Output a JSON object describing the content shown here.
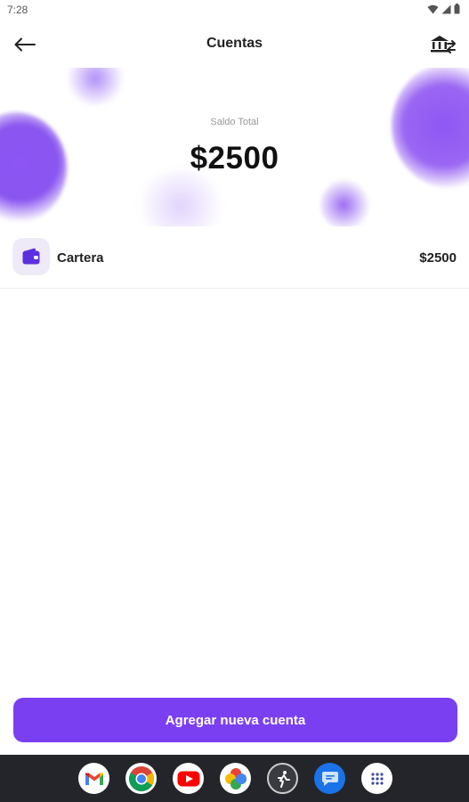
{
  "status_bar": {
    "time": "7:28",
    "icons": [
      "wifi-icon",
      "signal-icon",
      "battery-icon"
    ]
  },
  "app_bar": {
    "title": "Cuentas",
    "back_icon": "arrow-left-icon",
    "action_icon": "bank-transfer-icon"
  },
  "summary": {
    "label": "Saldo Total",
    "amount": "$2500"
  },
  "accounts": [
    {
      "name": "Cartera",
      "amount": "$2500",
      "icon": "wallet-icon"
    }
  ],
  "add_button": {
    "label": "Agregar nueva cuenta"
  },
  "taskbar": {
    "apps": [
      "gmail-icon",
      "chrome-icon",
      "youtube-icon",
      "photos-icon",
      "fitness-icon",
      "messages-icon",
      "app-drawer-icon"
    ]
  },
  "colors": {
    "accent": "#7b3ff2",
    "wallet_bg": "#eeeaf8",
    "taskbar": "#24252a"
  }
}
